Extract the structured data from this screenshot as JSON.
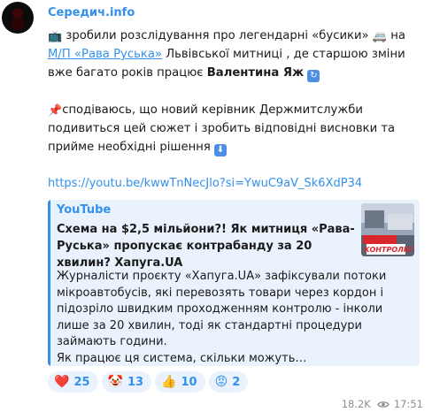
{
  "channel": {
    "name": "Середич.info"
  },
  "message": {
    "p1_a": "зробили розслідування про легендарні «бусики»",
    "p1_b": "на",
    "p1_link": "М/П «Рава Руська»",
    "p1_c": "Львівської митниці , де старшою зміни вже багато років працює",
    "p1_name": "Валентина Яж",
    "p2": "сподіваюсь, що новий керівник Держмитслужби подивиться цей сюжет і зробить відповідні висновки та прийме необхідні рішення",
    "link": "https://youtu.be/kwwTnNecJlo?si=YwuC9aV_Sk6XdP34"
  },
  "preview": {
    "site": "YouTube",
    "title": "Схема на $2,5 мільйони?! Як митниця «Рава-Руська» пропускає контрабанду за 20 хвилин? Хапуга.UA",
    "description": "Журналісти проєкту «Хапуга.UA» зафіксували потоки мікроавтобусів, які перевозять товари через кордон і підозріло швидким проходженням контролю - інколи лише за 20 хвилин, тоді як стандартні процедури займають години.\nЯк працює ця система, скільки можуть…",
    "thumb_text": "ДОН КОНТРОЛЮ?"
  },
  "reactions": [
    {
      "icon": "heart-emoji",
      "count": "25"
    },
    {
      "icon": "clown-emoji",
      "count": "13"
    },
    {
      "icon": "thumbs-up-emoji",
      "count": "10"
    },
    {
      "icon": "pouting-face-emoji",
      "count": "2"
    }
  ],
  "meta": {
    "views": "18.2K",
    "time": "17:51"
  },
  "colors": {
    "accent": "#3390ec",
    "preview_bg": "#eaf3fd"
  }
}
